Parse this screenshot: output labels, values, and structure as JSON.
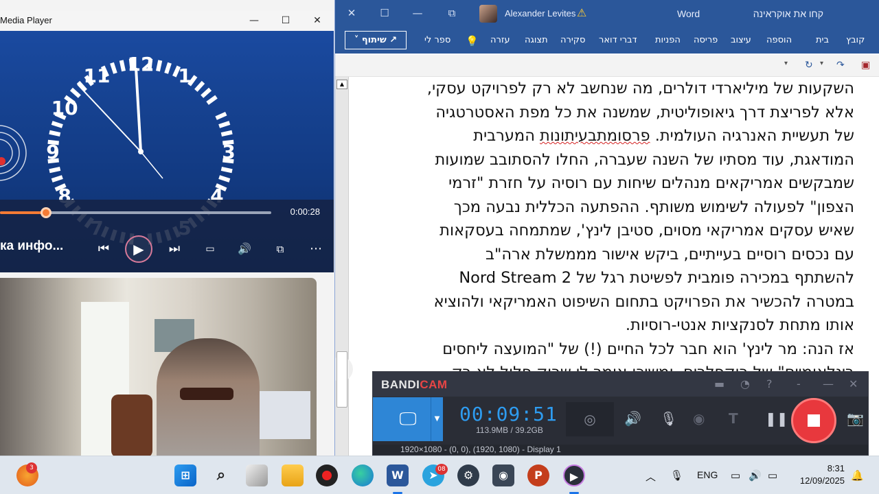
{
  "media_player": {
    "title": "Media Player",
    "window_buttons": {
      "minimize": "—",
      "maximize": "☐",
      "close": "✕"
    },
    "caption": "ка инфо...",
    "time": "0:00:28",
    "progress_fraction": 0.17,
    "clock_numerals": [
      "12",
      "1",
      "3",
      "4",
      "5",
      "7",
      "8",
      "9",
      "10",
      "11"
    ]
  },
  "word": {
    "window_buttons": {
      "close": "✕",
      "restore": "☐",
      "minimize": "—",
      "focus": "⧉"
    },
    "user_name": "Alexander Levites",
    "app_name": "Word",
    "doc_title": "קחו את אוקראינה",
    "share_label": "שיתוף",
    "ribbon_tabs": [
      "קובץ",
      "בית",
      "הוספה",
      "עיצוב",
      "פריסה",
      "הפניות",
      "דברי דואר",
      "סקירה",
      "תצוגה",
      "עזרה",
      "ספר לי"
    ],
    "body_lines": [
      "השקעות של מיליארדי דולרים, מה שנחשב לא רק לפרויקט עסקי,",
      "אלא לפריצת דרך גיאופוליטית, שמשנה את כל מפת האסטרטגיה",
      "של תעשיית האנרגיה העולמית. ",
      "המודאגת, עוד מסתיו של השנה שעברה, החלו להסתובב שמועות",
      "שמבקשים אמריקאים מנהלים שיחות עם רוסיה על חזרת \"זרמי",
      "הצפון\" לפעולה לשימוש משותף. ההפתעה הכללית נבעה מכך",
      "שאיש עסקים אמריקאי מסוים, סטיבן לינץ', שמתמחה בעסקאות",
      "עם נכסים רוסיים בעייתיים, ביקש אישור מממשלת ארה\"ב",
      "להשתתף במכירה פומבית לפשיטת רגל של Nord Stream 2",
      "במטרה להכשיר את הפרויקט בתחום השיפוט האמריקאי ולהוציא",
      "אותו מתחת לסנקציות אנטי-רוסיות.",
      "אז הנה: מר לינץ' הוא חבר לכל החיים (!) של \"המועצה ליחסים",
      "בינלאומיים\" של רוקפלרים, ומשיכן אומר לי שרוק פלול לא רק"
    ],
    "line3_misspelled": "פרסומתבעיתונות",
    "line3_tail": " המערבית"
  },
  "bandicam": {
    "logo_main": "BANDI",
    "logo_accent": "CAM",
    "rec_time": "00:09:51",
    "file_size": "113.9MB / 39.2GB",
    "footer": "1920×1080 - (0, 0), (1920, 1080) - Display 1",
    "accent": "#2e86d6",
    "record_color": "#e8383d"
  },
  "taskbar": {
    "notification_badge": "3",
    "telegram_badge": "08",
    "language": "ENG",
    "time": "8:31",
    "date": "12/09/2025"
  }
}
